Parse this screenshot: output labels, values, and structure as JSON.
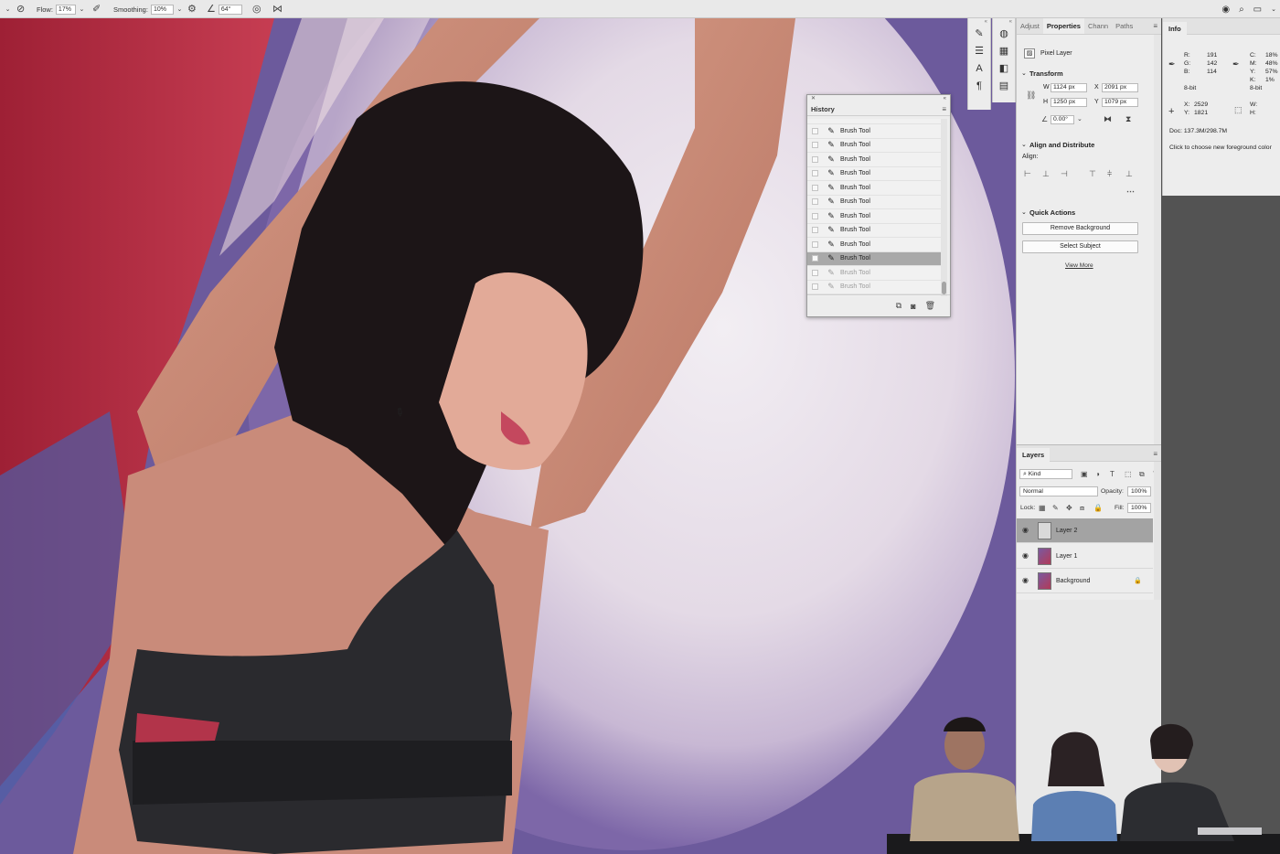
{
  "options_bar": {
    "flow_label": "Flow:",
    "flow_value": "17%",
    "smoothing_label": "Smoothing:",
    "smoothing_value": "10%",
    "angle_value": "64°"
  },
  "history": {
    "title": "History",
    "items": [
      {
        "label": "Brush Tool",
        "state": "normal"
      },
      {
        "label": "Brush Tool",
        "state": "normal"
      },
      {
        "label": "Brush Tool",
        "state": "normal"
      },
      {
        "label": "Brush Tool",
        "state": "normal"
      },
      {
        "label": "Brush Tool",
        "state": "normal"
      },
      {
        "label": "Brush Tool",
        "state": "normal"
      },
      {
        "label": "Brush Tool",
        "state": "normal"
      },
      {
        "label": "Brush Tool",
        "state": "normal"
      },
      {
        "label": "Brush Tool",
        "state": "normal"
      },
      {
        "label": "Brush Tool",
        "state": "selected"
      },
      {
        "label": "Brush Tool",
        "state": "dim"
      },
      {
        "label": "Brush Tool",
        "state": "dim"
      }
    ]
  },
  "properties": {
    "tabs": [
      "Adjust",
      "Properties",
      "Chann",
      "Paths"
    ],
    "active_tab": "Properties",
    "layer_kind": "Pixel Layer",
    "transform": {
      "title": "Transform",
      "w_label": "W",
      "w_value": "1124 px",
      "x_label": "X",
      "x_value": "2091 px",
      "h_label": "H",
      "h_value": "1250 px",
      "y_label": "Y",
      "y_value": "1079 px",
      "angle_value": "0.00°"
    },
    "align": {
      "title": "Align and Distribute",
      "align_label": "Align:"
    },
    "quick_actions": {
      "title": "Quick Actions",
      "remove_background": "Remove Background",
      "select_subject": "Select Subject",
      "view_more": "View More"
    }
  },
  "info": {
    "title": "Info",
    "r_label": "R:",
    "r_value": "191",
    "g_label": "G:",
    "g_value": "142",
    "b_label": "B:",
    "b_value": "114",
    "bit_left": "8-bit",
    "c_label": "C:",
    "c_value": "18%",
    "m_label": "M:",
    "m_value": "48%",
    "y_label": "Y:",
    "y_value": "57%",
    "k_label": "K:",
    "k_value": "1%",
    "bit_right": "8-bit",
    "x_label": "X:",
    "x_value": "2529",
    "ypos_label": "Y:",
    "ypos_value": "1821",
    "w_label": "W:",
    "h_label": "H:",
    "doc": "Doc: 137.3M/298.7M",
    "hint": "Click to choose new foreground color"
  },
  "layers": {
    "title": "Layers",
    "filter_kind": "Kind",
    "blend_mode": "Normal",
    "opacity_label": "Opacity:",
    "opacity_value": "100%",
    "lock_label": "Lock:",
    "fill_label": "Fill:",
    "fill_value": "100%",
    "items": [
      {
        "name": "Layer 2",
        "selected": true,
        "locked": false
      },
      {
        "name": "Layer 1",
        "selected": false,
        "locked": false
      },
      {
        "name": "Background",
        "selected": false,
        "locked": true
      }
    ]
  }
}
